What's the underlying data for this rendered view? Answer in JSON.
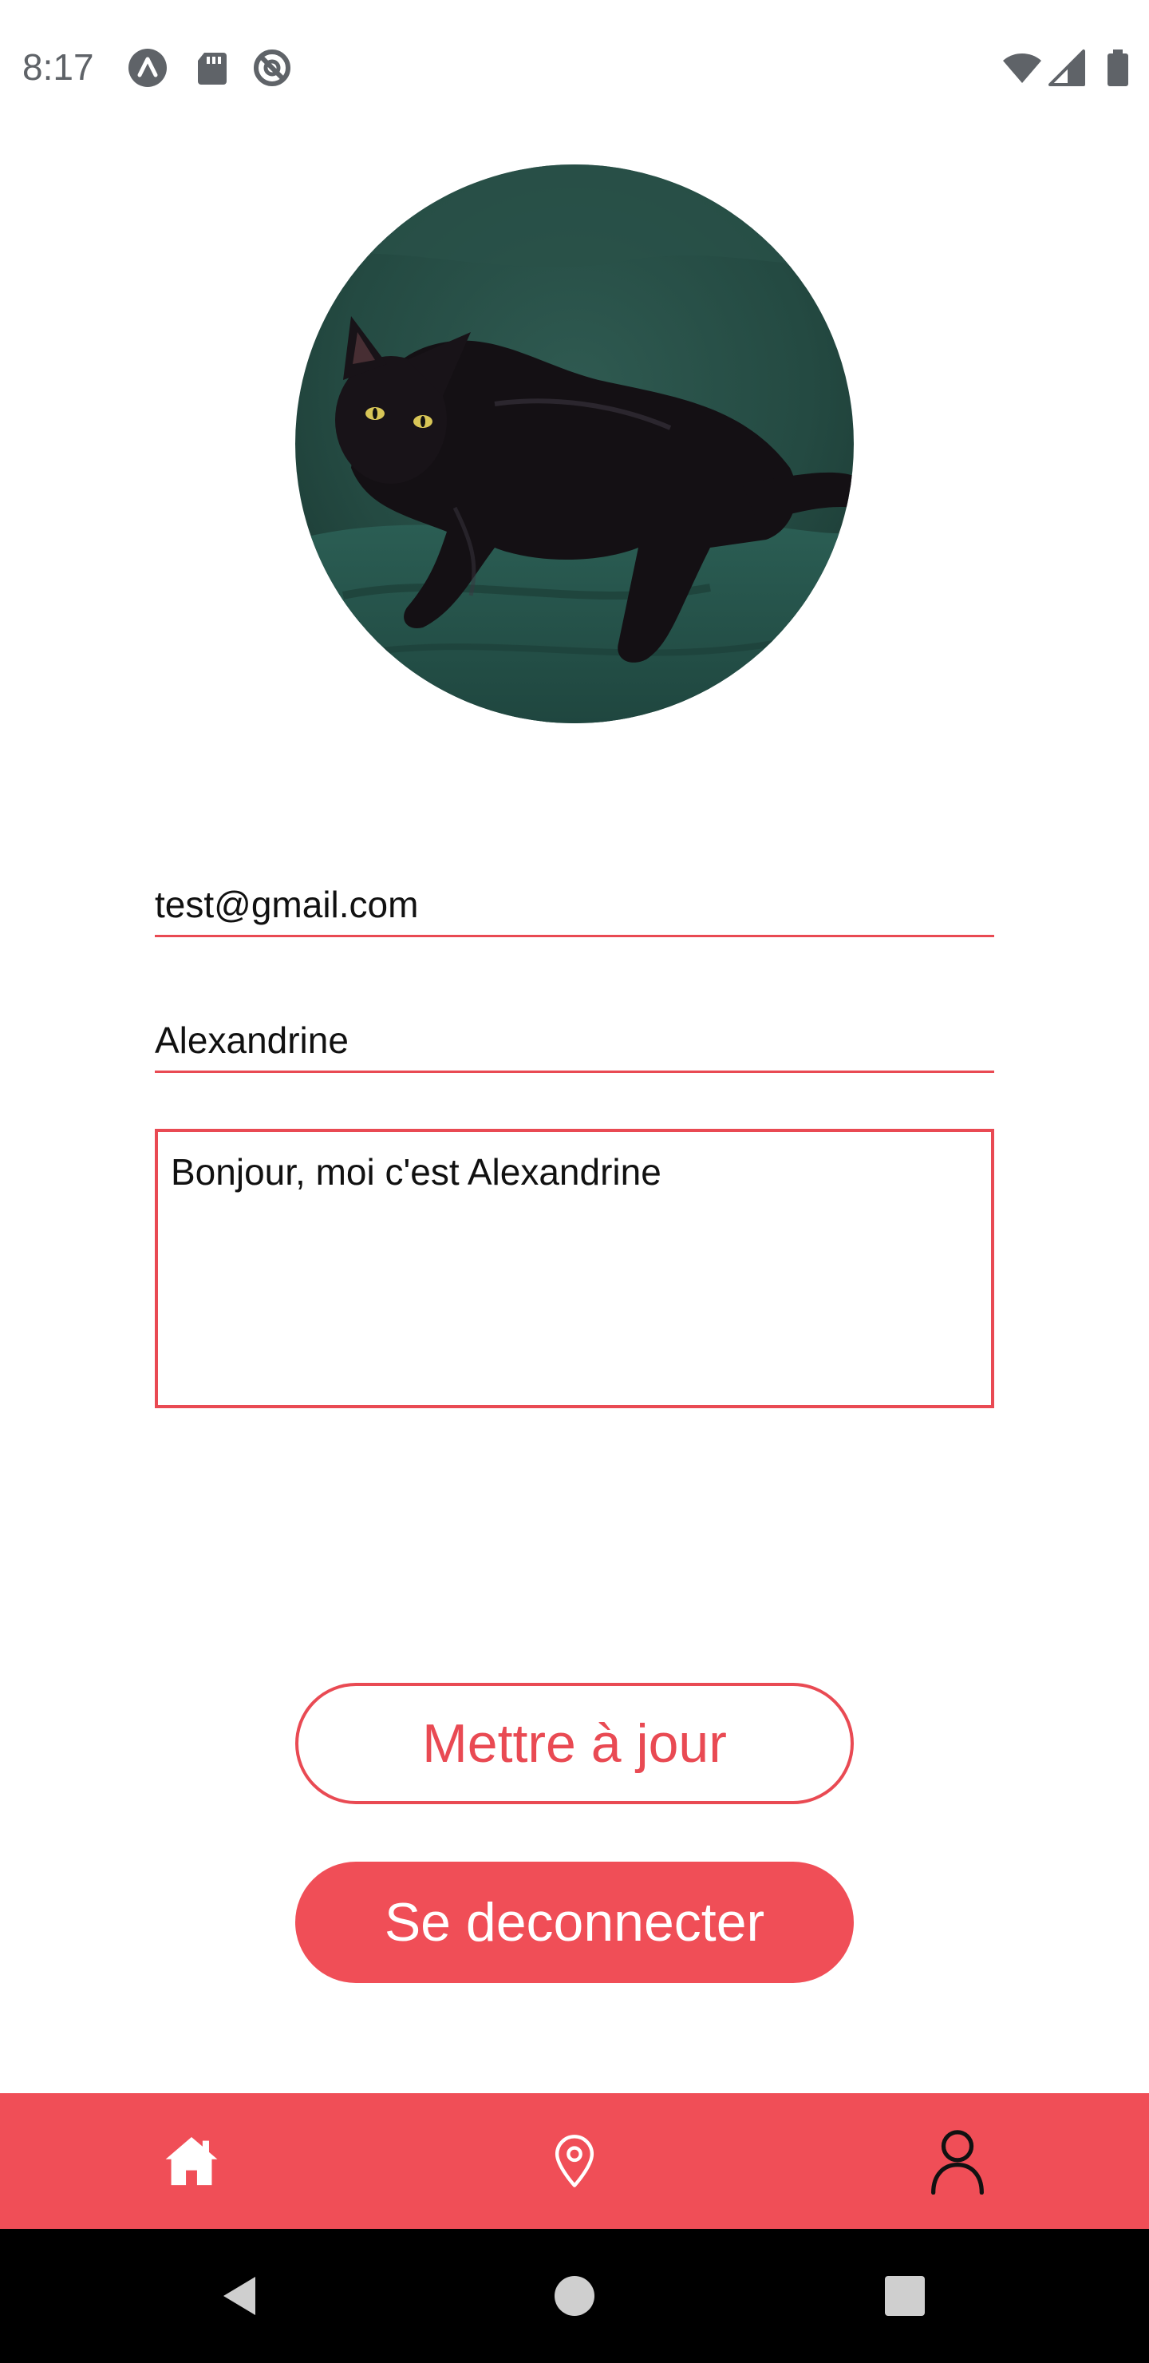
{
  "status_bar": {
    "time": "8:17",
    "left_icons": [
      "app-logo-icon",
      "sd-card-icon",
      "do-not-disturb-icon"
    ],
    "right_icons": [
      "wifi-icon",
      "cell-signal-icon",
      "battery-icon"
    ]
  },
  "profile": {
    "avatar_alt": "black-cat-photo",
    "email": "test@gmail.com",
    "name": "Alexandrine",
    "bio": "Bonjour, moi c'est Alexandrine"
  },
  "buttons": {
    "update_label": "Mettre à jour",
    "logout_label": "Se deconnecter"
  },
  "tab_bar": {
    "items": [
      {
        "icon": "home-icon",
        "selected": true
      },
      {
        "icon": "location-pin-icon",
        "selected": false
      },
      {
        "icon": "user-icon",
        "selected": false
      }
    ]
  },
  "nav_bar": {
    "items": [
      "back-icon",
      "home-circle-icon",
      "recents-icon"
    ]
  },
  "colors": {
    "accent": "#f04e57",
    "accent_border": "#e94a53",
    "background": "#ffffff",
    "nav_background": "#000000"
  }
}
